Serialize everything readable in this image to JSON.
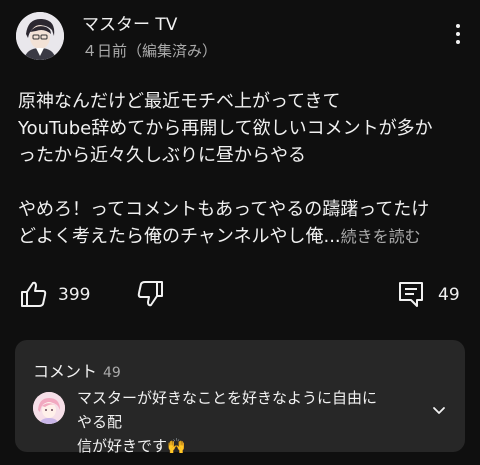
{
  "header": {
    "channel_name": "マスター TV",
    "post_time": "４日前（編集済み）"
  },
  "post": {
    "line1": "原神なんだけど最近モチベ上がってきて",
    "line2": "YouTube辞めてから再開して欲しいコメントが多か",
    "line3": "ったから近々久しぶりに昼からやる",
    "line4": "やめろ！ってコメントもあってやるの躊躇ってたけ",
    "line5": "どよく考えたら俺のチャンネルやし俺",
    "ellipsis": "...",
    "read_more": "続きを読む"
  },
  "actions": {
    "like_count": "399",
    "comment_count": "49",
    "icons": [
      "thumbs-up-icon",
      "thumbs-down-icon",
      "comment-icon"
    ]
  },
  "comments": {
    "title": "コメント",
    "count": "49",
    "top_comment_line1": "マスターが好きなことを好きなように自由にやる配",
    "top_comment_line2": "信が好きです🙌",
    "icons": [
      "chevron-down-icon"
    ]
  },
  "colors": {
    "background": "#0f0f0f",
    "card": "#272727",
    "text": "#f1f1f1",
    "secondary_text": "#aaaaaa"
  }
}
